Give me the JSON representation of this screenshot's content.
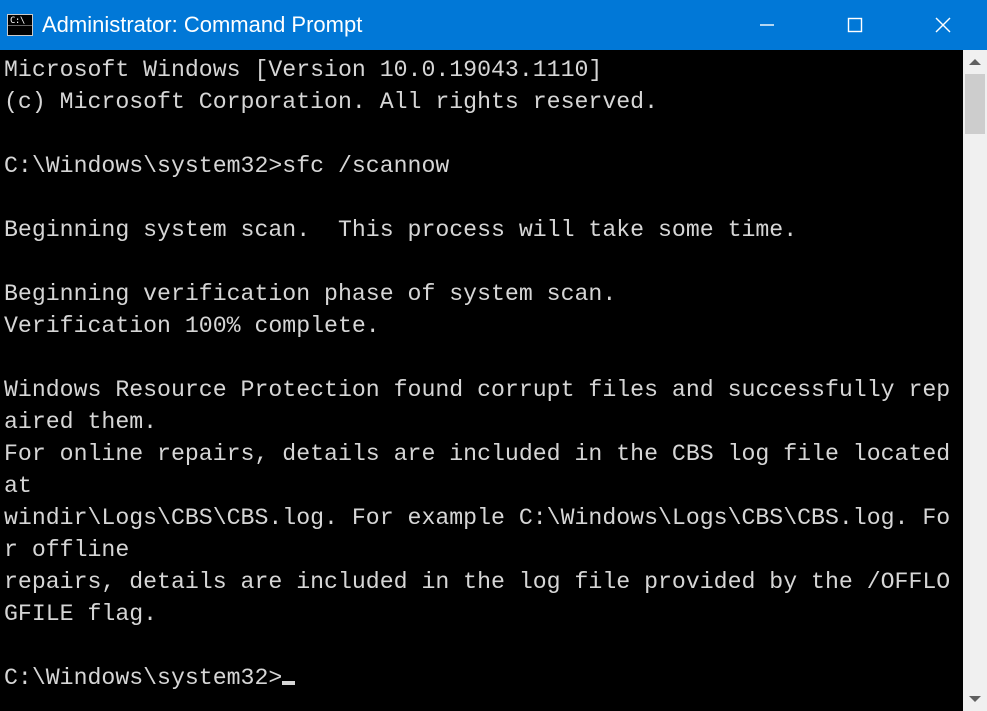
{
  "window": {
    "title": "Administrator: Command Prompt"
  },
  "console": {
    "line_version": "Microsoft Windows [Version 10.0.19043.1110]",
    "line_copyright": "(c) Microsoft Corporation. All rights reserved.",
    "prompt1_path": "C:\\Windows\\system32>",
    "prompt1_command": "sfc /scannow",
    "line_begin_scan": "Beginning system scan.  This process will take some time.",
    "line_begin_verify": "Beginning verification phase of system scan.",
    "line_verify_complete": "Verification 100% complete.",
    "line_result1": "Windows Resource Protection found corrupt files and successfully repaired them.",
    "line_result2": "For online repairs, details are included in the CBS log file located at",
    "line_result3": "windir\\Logs\\CBS\\CBS.log. For example C:\\Windows\\Logs\\CBS\\CBS.log. For offline",
    "line_result4": "repairs, details are included in the log file provided by the /OFFLOGFILE flag.",
    "prompt2_path": "C:\\Windows\\system32>"
  }
}
